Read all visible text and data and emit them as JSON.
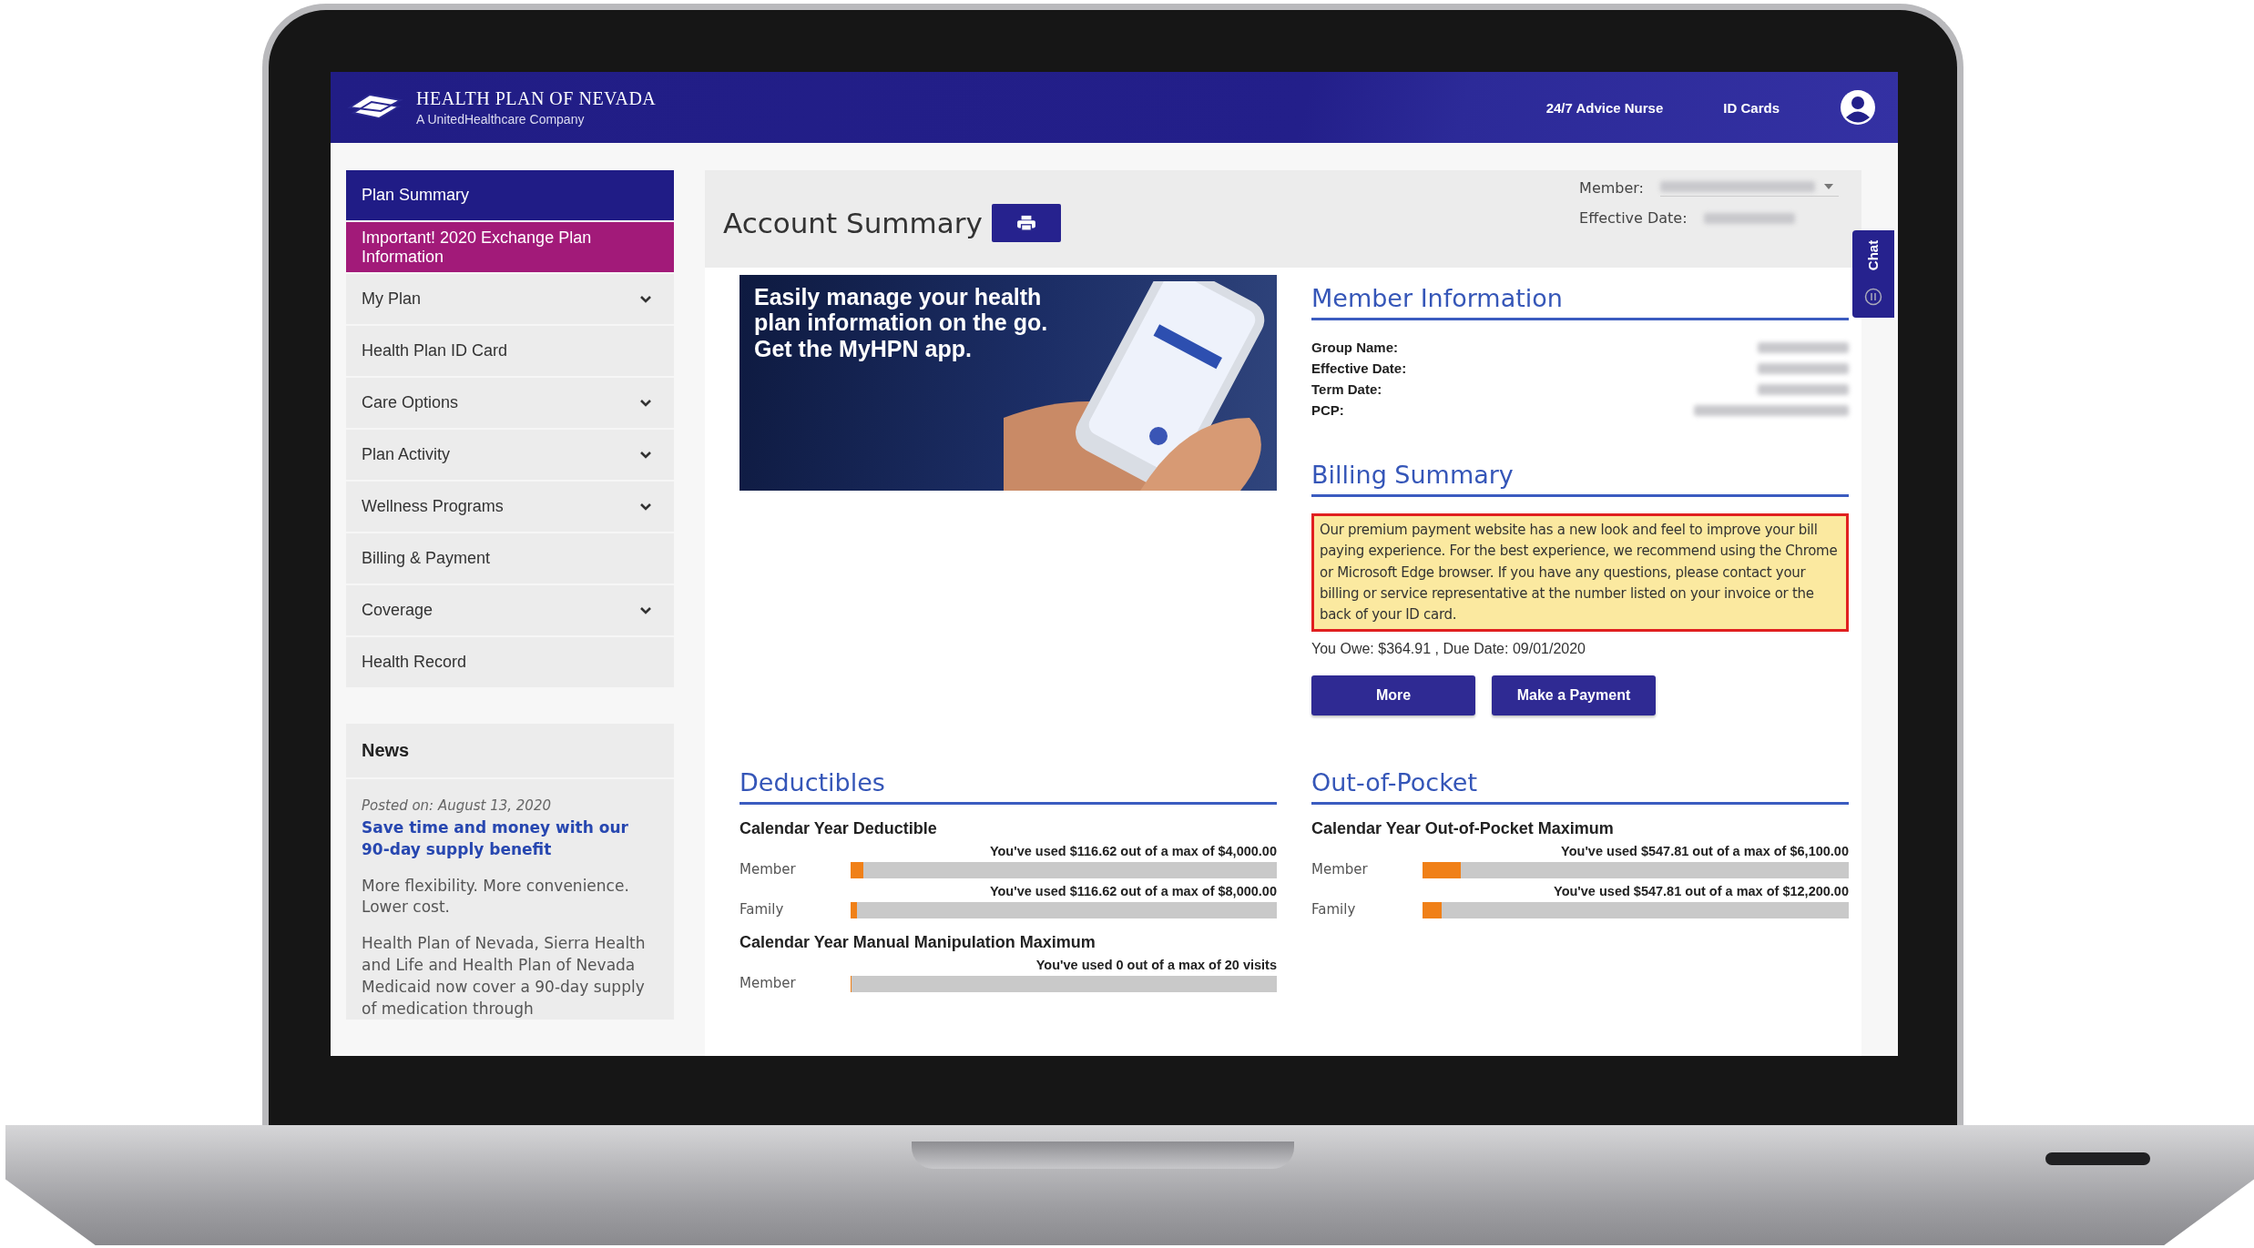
{
  "header": {
    "brand": "HEALTH PLAN OF NEVADA",
    "tagline": "A UnitedHealthcare Company",
    "links": [
      "24/7 Advice Nurse",
      "ID Cards"
    ]
  },
  "sidebar": {
    "items": [
      {
        "label": "Plan Summary",
        "kind": "nav",
        "selected": true,
        "expandable": false
      },
      {
        "label": "Important! 2020 Exchange Plan Information",
        "kind": "notice",
        "selected": false,
        "expandable": false
      },
      {
        "label": "My Plan",
        "kind": "nav",
        "selected": false,
        "expandable": true
      },
      {
        "label": "Health Plan ID Card",
        "kind": "nav",
        "selected": false,
        "expandable": false
      },
      {
        "label": "Care Options",
        "kind": "nav",
        "selected": false,
        "expandable": true
      },
      {
        "label": "Plan Activity",
        "kind": "nav",
        "selected": false,
        "expandable": true
      },
      {
        "label": "Wellness Programs",
        "kind": "nav",
        "selected": false,
        "expandable": true
      },
      {
        "label": "Billing & Payment",
        "kind": "nav",
        "selected": false,
        "expandable": false
      },
      {
        "label": "Coverage",
        "kind": "nav",
        "selected": false,
        "expandable": true
      },
      {
        "label": "Health Record",
        "kind": "nav",
        "selected": false,
        "expandable": false
      }
    ]
  },
  "news": {
    "title": "News",
    "posted": "Posted on: August 13, 2020",
    "headline": "Save time and money with our 90-day supply benefit",
    "paragraphs": [
      "More flexibility. More convenience. Lower cost.",
      "Health Plan of Nevada, Sierra Health and Life and Health Plan of Nevada Medicaid now cover a 90-day supply of medication through"
    ]
  },
  "account": {
    "title": "Account Summary",
    "member_label": "Member:",
    "effective_label": "Effective Date:"
  },
  "promo": {
    "text": "Easily manage your health plan information on the go. Get the MyHPN app."
  },
  "member_info": {
    "title": "Member Information",
    "fields": [
      "Group Name:",
      "Effective Date:",
      "Term Date:",
      "PCP:"
    ]
  },
  "billing": {
    "title": "Billing Summary",
    "notice": "Our premium payment website has a new look and feel to improve your bill paying experience. For the best experience, we recommend using the Chrome or Microsoft Edge browser. If you have any questions, please contact your billing or service representative at the number listed on your invoice or the back of your ID card.",
    "owed": "You Owe: $364.91 , Due Date: 09/01/2020",
    "buttons": [
      "More",
      "Make a Payment"
    ]
  },
  "deductibles": {
    "title": "Deductibles",
    "groups": [
      {
        "heading": "Calendar Year Deductible",
        "rows": [
          {
            "label": "Member",
            "usage": "You've used $116.62 out of a max of $4,000.00",
            "level": 0.029
          },
          {
            "label": "Family",
            "usage": "You've used $116.62 out of a max of $8,000.00",
            "level": 0.015
          }
        ]
      },
      {
        "heading": "Calendar Year Manual Manipulation Maximum",
        "rows": [
          {
            "label": "Member",
            "usage": "You've used 0 out of a max of 20 visits",
            "level": 0
          }
        ]
      }
    ]
  },
  "out_of_pocket": {
    "title": "Out-of-Pocket",
    "groups": [
      {
        "heading": "Calendar Year Out-of-Pocket Maximum",
        "rows": [
          {
            "label": "Member",
            "usage": "You've used $547.81 out of a max of $6,100.00",
            "level": 0.09
          },
          {
            "label": "Family",
            "usage": "You've used $547.81 out of a max of $12,200.00",
            "level": 0.045
          }
        ]
      }
    ]
  },
  "chat": {
    "label": "Chat"
  }
}
